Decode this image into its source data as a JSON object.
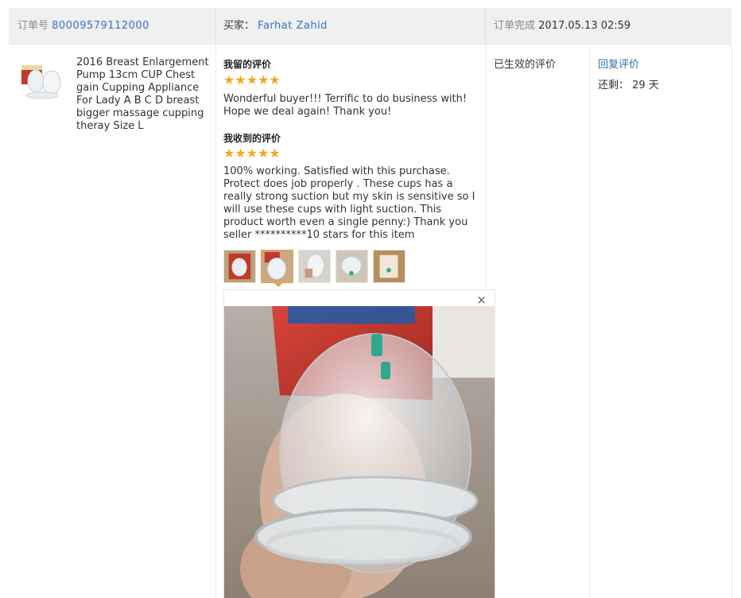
{
  "header": {
    "order_label": "订单号",
    "order_number": "80009579112000",
    "buyer_label": "买家：",
    "buyer_name": "Farhat Zahid",
    "completed_label": "订单完成",
    "completed_time": "2017.05.13 02:59"
  },
  "product": {
    "title": "2016 Breast Enlargement Pump 13cm CUP Chest gain Cupping Appliance For Lady A B C D breast bigger massage cupping theray Size L"
  },
  "my_review": {
    "title": "我留的评价",
    "stars": "★★★★★",
    "rating": 5,
    "text": "Wonderful buyer!!! Terrific to do business with! Hope we deal again! Thank you!"
  },
  "received_review": {
    "title": "我收到的评价",
    "stars": "★★★★★",
    "rating": 5,
    "text": "100% working. Satisfied with this purchase. Protect does job properly . These cups has a really strong suction but my skin is sensitive so I will use these cups with light suction. This product worth even a single penny:) Thank you seller **********10 stars for this item"
  },
  "gallery": {
    "count": 5,
    "selected_index": 1,
    "close_label": "×"
  },
  "status": {
    "label": "已生效的评价"
  },
  "actions": {
    "reply_label": "回复评价",
    "remain_label": "还剩：",
    "remain_value": "29 天"
  },
  "colors": {
    "star": "#f5a623",
    "link": "#2d6fa8",
    "header_bg": "#f0f0f0",
    "active_border": "#e7a23a"
  }
}
